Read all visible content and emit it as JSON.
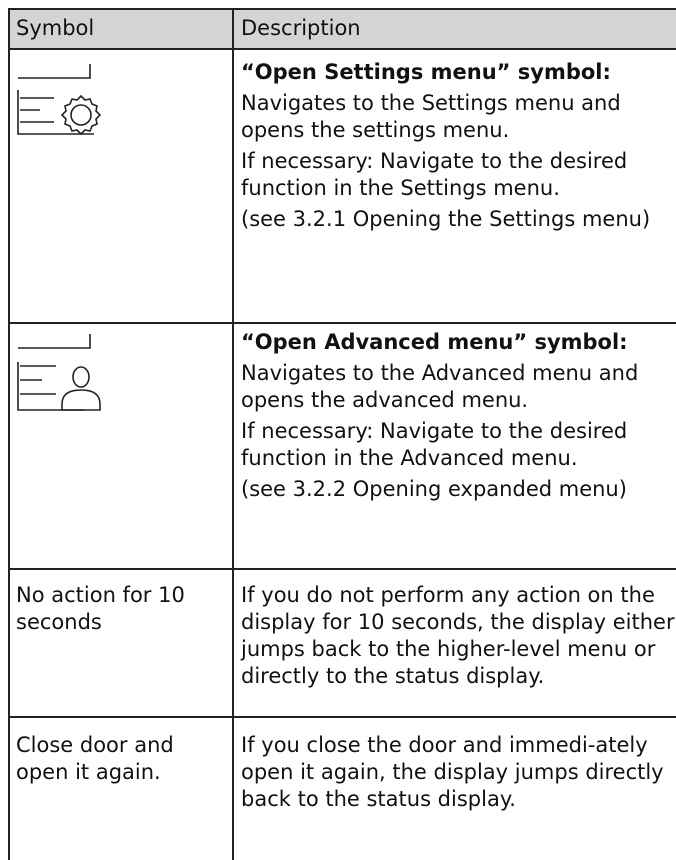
{
  "table": {
    "headers": {
      "symbol": "Symbol",
      "description": "Description"
    },
    "rows": [
      {
        "symbol_icon": "settings-menu-icon",
        "title": "“Open Settings menu” symbol:",
        "paragraphs": [
          "Navigates to the Settings menu and opens the settings menu.",
          "If necessary: Navigate to the desired function in the Settings menu.",
          "(see 3.2.1 Opening the Settings menu)"
        ]
      },
      {
        "symbol_icon": "advanced-menu-user-icon",
        "title": "“Open Advanced menu” symbol:",
        "paragraphs": [
          "Navigates to the Advanced menu and opens the advanced menu.",
          "If necessary: Navigate to the desired function in the Advanced menu.",
          "(see 3.2.2 Opening expanded menu)"
        ]
      },
      {
        "symbol_text": "No action for 10 seconds",
        "paragraphs": [
          "If you do not perform any action on the display for 10 seconds, the display either jumps back to the higher-level menu or directly to the status display."
        ]
      },
      {
        "symbol_text": "Close door and open it again.",
        "paragraphs": [
          "If you close the door and immedi-ately open it again, the display jumps directly back to the status display."
        ]
      }
    ]
  }
}
